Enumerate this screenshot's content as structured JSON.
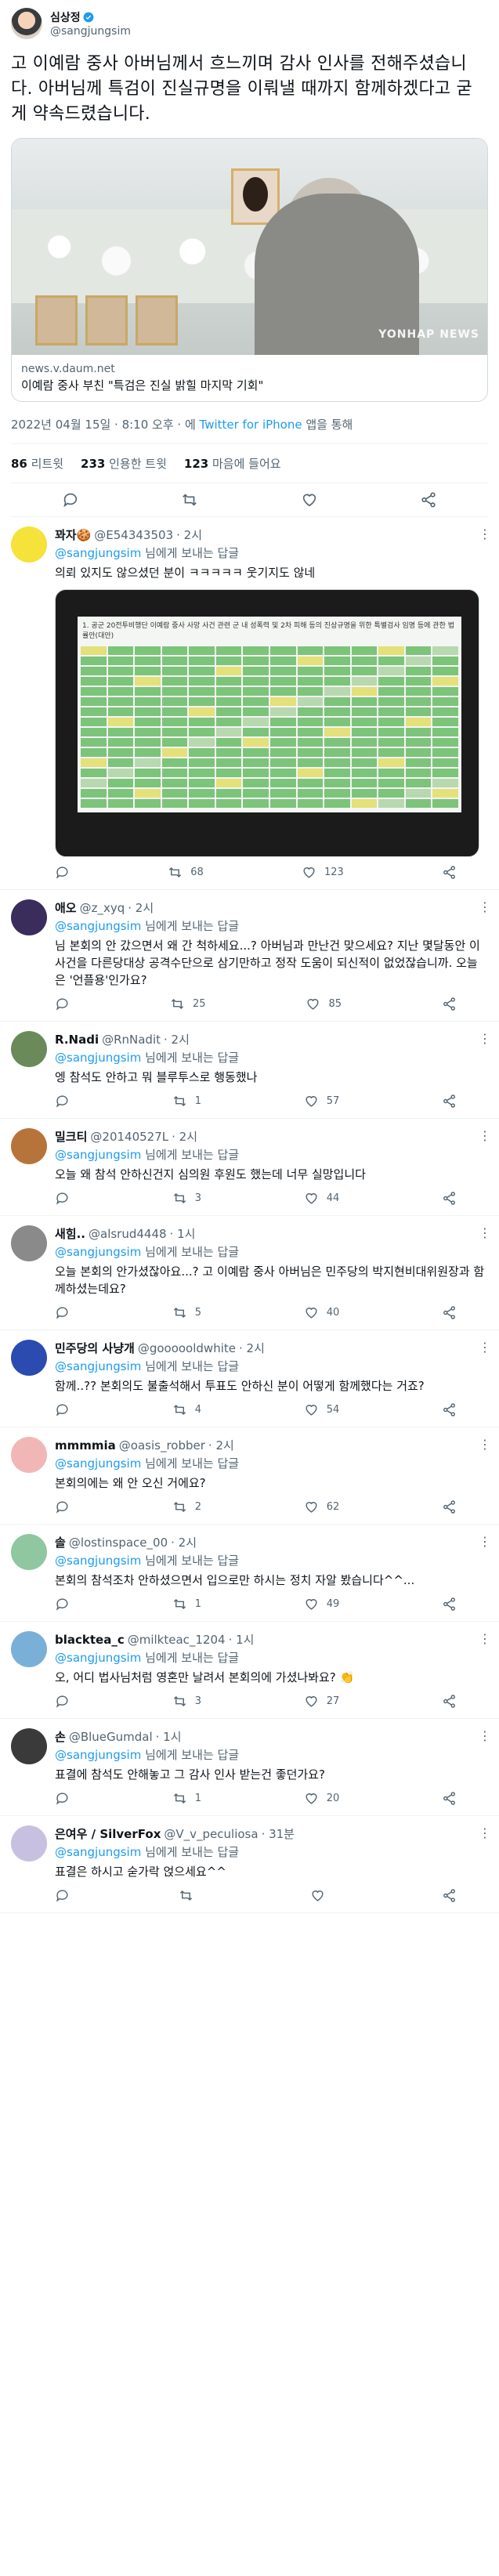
{
  "tweet": {
    "author_name": "심상정",
    "author_handle": "@sangjungsim",
    "text": "고 이예람 중사 아버님께서 흐느끼며 감사 인사를 전해주셨습니다. 아버님께 특검이 진실규명을 이뤄낼 때까지 함께하겠다고 굳게 약속드렸습니다.",
    "card_domain": "news.v.daum.net",
    "card_title": "이예람 중사 부친 \"특검은 진실 밝힐 마지막 기회\"",
    "watermark": "YONHAP NEWS",
    "datetime": "2022년 04월 15일 · 8:10 오후 · 에 ",
    "via": "Twitter for iPhone",
    "via_suffix": " 앱을 통해",
    "stats": {
      "retweets_num": "86",
      "retweets_label": " 리트윗",
      "quotes_num": "233",
      "quotes_label": " 인용한 트윗",
      "likes_num": "123",
      "likes_label": " 마음에 들어요"
    }
  },
  "reply_to_label": "님에게 보내는 답글",
  "reply_to_handle": "@sangjungsim",
  "replies": [
    {
      "name": "꽈자🍪",
      "handle": "@E54343503",
      "time": "· 2시",
      "text": "의뢰 있지도 않으셨던 분이 ㅋㅋㅋㅋㅋ 웃기지도 않네",
      "retweets": "68",
      "likes": "123",
      "avatar_color": "#f5e23a",
      "has_image": true
    },
    {
      "name": "애오",
      "handle": "@z_xyq",
      "time": "· 2시",
      "text": "님 본회의 안 갔으면서 왜 간 척하세요...? 아버님과 만난건 맞으세요? 지난 몇달동안 이 사건을 다른당대상 공격수단으로 삼기만하고 정작 도움이 되신적이 없었잖습니까. 오늘은 '언플용'인가요?",
      "retweets": "25",
      "likes": "85",
      "avatar_color": "#3a2d5c"
    },
    {
      "name": "R.Nadi",
      "handle": "@RnNadit",
      "time": "· 2시",
      "text": "엥 참석도 안하고 뭐 블루투스로 행동했나",
      "retweets": "1",
      "likes": "57",
      "avatar_color": "#6a8a5a"
    },
    {
      "name": "밀크티",
      "handle": "@20140527L",
      "time": "· 2시",
      "text": "오늘 왜 참석 안하신건지 심의원 후원도 했는데 너무 실망입니다",
      "retweets": "3",
      "likes": "44",
      "avatar_color": "#b7743a"
    },
    {
      "name": "새힘..",
      "handle": "@alsrud4448",
      "time": "· 1시",
      "text": "오늘 본회의 안가셨잖아요...? 고 이예람 중사 아버님은 민주당의 박지현비대위원장과 함께하셨는데요?",
      "retweets": "5",
      "likes": "40",
      "avatar_color": "#8a8a8a"
    },
    {
      "name": "민주당의 사냥개",
      "handle": "@goooooldwhite",
      "time": "· 2시",
      "text": "함께..?? 본회의도 불출석해서 투표도 안하신 분이 어떻게 함께했다는 거죠?",
      "retweets": "4",
      "likes": "54",
      "avatar_color": "#2b4bb0"
    },
    {
      "name": "mmmmia",
      "handle": "@oasis_robber",
      "time": "· 2시",
      "text": "본회의에는 왜 안 오신 거에요?",
      "retweets": "2",
      "likes": "62",
      "avatar_color": "#f1b7b7"
    },
    {
      "name": "솔",
      "handle": "@lostinspace_00",
      "time": "· 2시",
      "text": "본회의 참석조차 안하셨으면서 입으로만 하시는 정치 자알 봤습니다^^...",
      "retweets": "1",
      "likes": "49",
      "avatar_color": "#8fc7a0"
    },
    {
      "name": "blacktea_c",
      "handle": "@milkteac_1204",
      "time": "· 1시",
      "text": "오, 어디 법사님처럼 영혼만 날려서 본회의에 가셨나봐요? 👏",
      "retweets": "3",
      "likes": "27",
      "avatar_color": "#7ab0d8"
    },
    {
      "name": "손",
      "handle": "@BlueGumdal",
      "time": "· 1시",
      "text": "표결에 참석도 안해놓고 그 감사 인사 받는건 좋던가요?",
      "retweets": "1",
      "likes": "20",
      "avatar_color": "#3a3a3a"
    },
    {
      "name": "은여우 / SilverFox",
      "handle": "@V_v_peculiosa",
      "time": "· 31분",
      "text": "표결은 하시고 숟가락 얹으세요^^",
      "retweets": "",
      "likes": "",
      "avatar_color": "#c8c0e0"
    }
  ],
  "spreadsheet_title": "1. 공군 20전투비행단 이예람 중사 사망 사건 관련 군 내 성폭력 및 2차 피해 등의 진상규명을 위한 특별검사 임명 등에 관한 법률안(대안)",
  "colors": {
    "accent": "#1d9bf0",
    "muted": "#536471"
  }
}
